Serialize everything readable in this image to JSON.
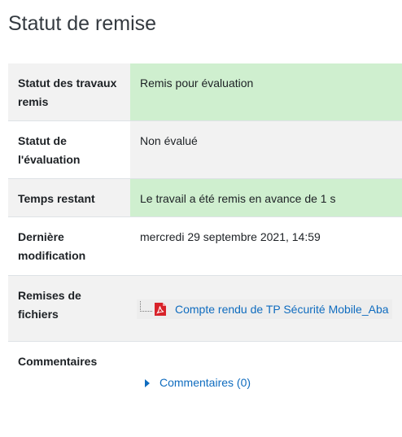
{
  "heading": "Statut de remise",
  "rows": [
    {
      "label": "Statut des travaux remis",
      "value": "Remis pour évaluation"
    },
    {
      "label": "Statut de l'évaluation",
      "value": "Non évalué"
    },
    {
      "label": "Temps restant",
      "value": "Le travail a été remis en avance de 1 s"
    },
    {
      "label": "Dernière modification",
      "value": "mercredi 29 septembre 2021, 14:59"
    },
    {
      "label": "Remises de fichiers",
      "file": {
        "name": "Compte rendu de TP Sécurité Mobile_Aba",
        "icon": "pdf-icon"
      }
    },
    {
      "label": "Commentaires",
      "link": "Commentaires (0)"
    }
  ],
  "colors": {
    "success_bg": "#cfefcf",
    "shaded_bg": "#f2f2f2",
    "link": "#0f6cbf",
    "pdf_red": "#d8232a"
  }
}
